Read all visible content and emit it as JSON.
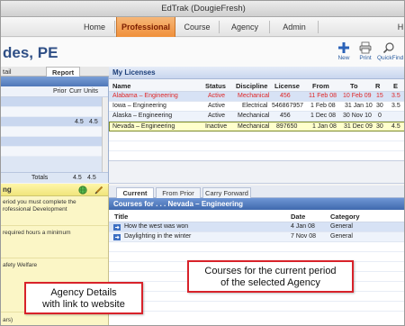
{
  "window": {
    "title": "EdTrak (DougieFresh)"
  },
  "nav": {
    "tabs": [
      {
        "label": "Home"
      },
      {
        "label": "Professional",
        "selected": true
      },
      {
        "label": "Course"
      },
      {
        "label": "Agency"
      },
      {
        "label": "Admin"
      },
      {
        "label": "H"
      }
    ]
  },
  "header": {
    "name": "des, PE",
    "tools": [
      {
        "label": "New",
        "icon": "plus-icon"
      },
      {
        "label": "Print",
        "icon": "printer-icon"
      },
      {
        "label": "QuickFind",
        "icon": "quickfind-icon"
      }
    ]
  },
  "subtabs": [
    {
      "label": "tail"
    },
    {
      "label": "Report",
      "selected": true
    }
  ],
  "left_panel": {
    "columns": [
      "Prior",
      "Curr",
      "Units"
    ],
    "rows": [
      {
        "curr": "",
        "units": ""
      },
      {
        "curr": "",
        "units": ""
      },
      {
        "curr": "4.5",
        "units": "4.5"
      },
      {
        "curr": "",
        "units": ""
      },
      {
        "curr": "",
        "units": ""
      },
      {
        "curr": "",
        "units": ""
      }
    ],
    "totals": {
      "label": "Totals",
      "curr": "4.5",
      "units": "4.5"
    }
  },
  "agency_panel": {
    "title": "ng",
    "lines": [
      "eriod you must complete the",
      "rofessional Development",
      "required hours a minimum",
      "afety Welfare",
      "ars)"
    ]
  },
  "licenses": {
    "title": "My Licenses",
    "columns": [
      "Name",
      "Status",
      "Discipline",
      "License",
      "From",
      "To",
      "R",
      "E"
    ],
    "rows": [
      {
        "name": "Alabama – Engineering",
        "status": "Active",
        "discipline": "Mechanical",
        "license": "456",
        "from": "11 Feb 08",
        "to": "10 Feb 09",
        "r": "15",
        "e": "3.5"
      },
      {
        "name": "Iowa – Engineering",
        "status": "Active",
        "discipline": "Electrical",
        "license": "546867957",
        "from": "1 Feb 08",
        "to": "31 Jan 10",
        "r": "30",
        "e": "3.5"
      },
      {
        "name": "Alaska – Engineering",
        "status": "Active",
        "discipline": "Mechanical",
        "license": "456",
        "from": "1 Dec 08",
        "to": "30 Nov 10",
        "r": "0",
        "e": ""
      },
      {
        "name": "Nevada – Engineering",
        "status": "Inactive",
        "discipline": "Mechanical",
        "license": "897650",
        "from": "1 Jan 08",
        "to": "31 Dec 09",
        "r": "30",
        "e": "4.5"
      }
    ]
  },
  "courses": {
    "tabs": [
      {
        "label": "Current",
        "selected": true
      },
      {
        "label": "From Prior"
      },
      {
        "label": "Carry Forward"
      }
    ],
    "title": "Courses for . . . Nevada – Engineering",
    "columns": [
      "Title",
      "Date",
      "Category"
    ],
    "rows": [
      {
        "title": "How the west was won",
        "date": "4 Jan 08",
        "category": "General"
      },
      {
        "title": "Daylighting in the winter",
        "date": "7 Nov 08",
        "category": "General"
      }
    ]
  },
  "callouts": {
    "courses": [
      "Courses for the current period",
      "of the selected Agency"
    ],
    "agency": [
      "Agency Details",
      "with link to website"
    ]
  },
  "colors": {
    "accent_tab": "#f08f3a",
    "header_blue": "#4f77b8",
    "inactive_row": "#ffffcc",
    "alert_text": "#e02626",
    "callout_border": "#d8222a"
  }
}
